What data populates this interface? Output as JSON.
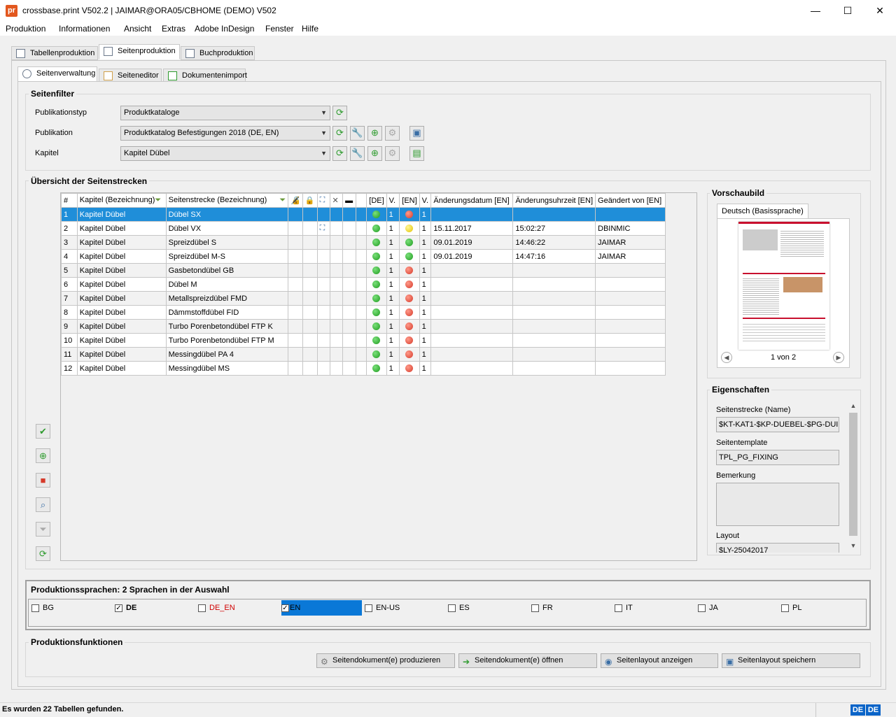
{
  "window": {
    "app_icon": "pr",
    "title": "crossbase.print V502.2 | JAIMAR@ORA05/CBHOME (DEMO) V502",
    "minimize": "—",
    "maximize": "☐",
    "close": "✕"
  },
  "menu": [
    "Produktion",
    "Informationen",
    "Ansicht",
    "Extras",
    "Adobe InDesign",
    "Fenster",
    "Hilfe"
  ],
  "main_tabs": [
    "Tabellenproduktion",
    "Seitenproduktion",
    "Buchproduktion"
  ],
  "sub_tabs": [
    "Seitenverwaltung",
    "Seiteneditor",
    "Dokumentenimport"
  ],
  "filter": {
    "title": "Seitenfilter",
    "publikationstyp_label": "Publikationstyp",
    "publikationstyp_value": "Produktkataloge",
    "publikation_label": "Publikation",
    "publikation_value": "Produktkatalog Befestigungen 2018 (DE, EN)",
    "kapitel_label": "Kapitel",
    "kapitel_value": "Kapitel Dübel"
  },
  "overview": {
    "title": "Übersicht der Seitenstrecken",
    "columns": [
      "#",
      "Kapitel (Bezeichnung)",
      "Seitenstrecke (Bezeichnung)",
      "[DE]",
      "V.",
      "[EN]",
      "V.",
      "Änderungsdatum [EN]",
      "Änderungsuhrzeit [EN]",
      "Geändert von [EN]"
    ],
    "rows": [
      {
        "n": "1",
        "kapitel": "Kapitel Dübel",
        "strecke": "Dübel SX",
        "de": "g",
        "vde": "1",
        "en": "r",
        "ven": "1",
        "datum": "",
        "zeit": "",
        "von": ""
      },
      {
        "n": "2",
        "kapitel": "Kapitel Dübel",
        "strecke": "Dübel VX",
        "de": "g",
        "vde": "1",
        "en": "y",
        "ven": "1",
        "datum": "15.11.2017",
        "zeit": "15:02:27",
        "von": "DBINMIC"
      },
      {
        "n": "3",
        "kapitel": "Kapitel Dübel",
        "strecke": "Spreizdübel S",
        "de": "g",
        "vde": "1",
        "en": "g+",
        "ven": "1",
        "datum": "09.01.2019",
        "zeit": "14:46:22",
        "von": "JAIMAR"
      },
      {
        "n": "4",
        "kapitel": "Kapitel Dübel",
        "strecke": "Spreizdübel M-S",
        "de": "g",
        "vde": "1",
        "en": "g",
        "ven": "1",
        "datum": "09.01.2019",
        "zeit": "14:47:16",
        "von": "JAIMAR"
      },
      {
        "n": "5",
        "kapitel": "Kapitel Dübel",
        "strecke": "Gasbetondübel GB",
        "de": "g",
        "vde": "1",
        "en": "r",
        "ven": "1",
        "datum": "",
        "zeit": "",
        "von": ""
      },
      {
        "n": "6",
        "kapitel": "Kapitel Dübel",
        "strecke": "Dübel M",
        "de": "g",
        "vde": "1",
        "en": "r",
        "ven": "1",
        "datum": "",
        "zeit": "",
        "von": ""
      },
      {
        "n": "7",
        "kapitel": "Kapitel Dübel",
        "strecke": "Metallspreizdübel FMD",
        "de": "g",
        "vde": "1",
        "en": "r",
        "ven": "1",
        "datum": "",
        "zeit": "",
        "von": ""
      },
      {
        "n": "8",
        "kapitel": "Kapitel Dübel",
        "strecke": "Dämmstoffdübel FID",
        "de": "g",
        "vde": "1",
        "en": "r",
        "ven": "1",
        "datum": "",
        "zeit": "",
        "von": ""
      },
      {
        "n": "9",
        "kapitel": "Kapitel Dübel",
        "strecke": "Turbo Porenbetondübel FTP K",
        "de": "g",
        "vde": "1",
        "en": "r",
        "ven": "1",
        "datum": "",
        "zeit": "",
        "von": ""
      },
      {
        "n": "10",
        "kapitel": "Kapitel Dübel",
        "strecke": "Turbo Porenbetondübel FTP M",
        "de": "g",
        "vde": "1",
        "en": "r",
        "ven": "1",
        "datum": "",
        "zeit": "",
        "von": ""
      },
      {
        "n": "11",
        "kapitel": "Kapitel Dübel",
        "strecke": "Messingdübel PA 4",
        "de": "g",
        "vde": "1",
        "en": "r",
        "ven": "1",
        "datum": "",
        "zeit": "",
        "von": ""
      },
      {
        "n": "12",
        "kapitel": "Kapitel Dübel",
        "strecke": "Messingdübel MS",
        "de": "g",
        "vde": "1",
        "en": "r",
        "ven": "1",
        "datum": "",
        "zeit": "",
        "von": ""
      }
    ]
  },
  "preview": {
    "title": "Vorschaubild",
    "tab": "Deutsch (Basissprache)",
    "pager": "1 von 2"
  },
  "properties": {
    "title": "Eigenschaften",
    "name_label": "Seitenstrecke (Name)",
    "name_value": "$KT-KAT1-$KP-DUEBEL-$PG-DUI",
    "template_label": "Seitentemplate",
    "template_value": "TPL_PG_FIXING",
    "remark_label": "Bemerkung",
    "layout_label": "Layout",
    "layout_value": "$LY-25042017"
  },
  "languages": {
    "title": "Produktionssprachen: 2 Sprachen in der Auswahl",
    "items": [
      {
        "code": "BG",
        "checked": false
      },
      {
        "code": "DE",
        "checked": true
      },
      {
        "code": "DE_EN",
        "checked": false
      },
      {
        "code": "EN",
        "checked": true
      },
      {
        "code": "EN-US",
        "checked": false
      },
      {
        "code": "ES",
        "checked": false
      },
      {
        "code": "FR",
        "checked": false
      },
      {
        "code": "IT",
        "checked": false
      },
      {
        "code": "JA",
        "checked": false
      },
      {
        "code": "PL",
        "checked": false
      }
    ]
  },
  "functions": {
    "title": "Produktionsfunktionen",
    "produce": "Seitendokument(e) produzieren",
    "open": "Seitendokument(e) öffnen",
    "show_layout": "Seitenlayout anzeigen",
    "save_layout": "Seitenlayout speichern"
  },
  "status": {
    "message": "Es wurden 22 Tabellen gefunden.",
    "lang1": "DE",
    "lang2": "DE"
  },
  "colors": {
    "selection": "#1f8ed9",
    "accent_red": "#e2571e"
  }
}
